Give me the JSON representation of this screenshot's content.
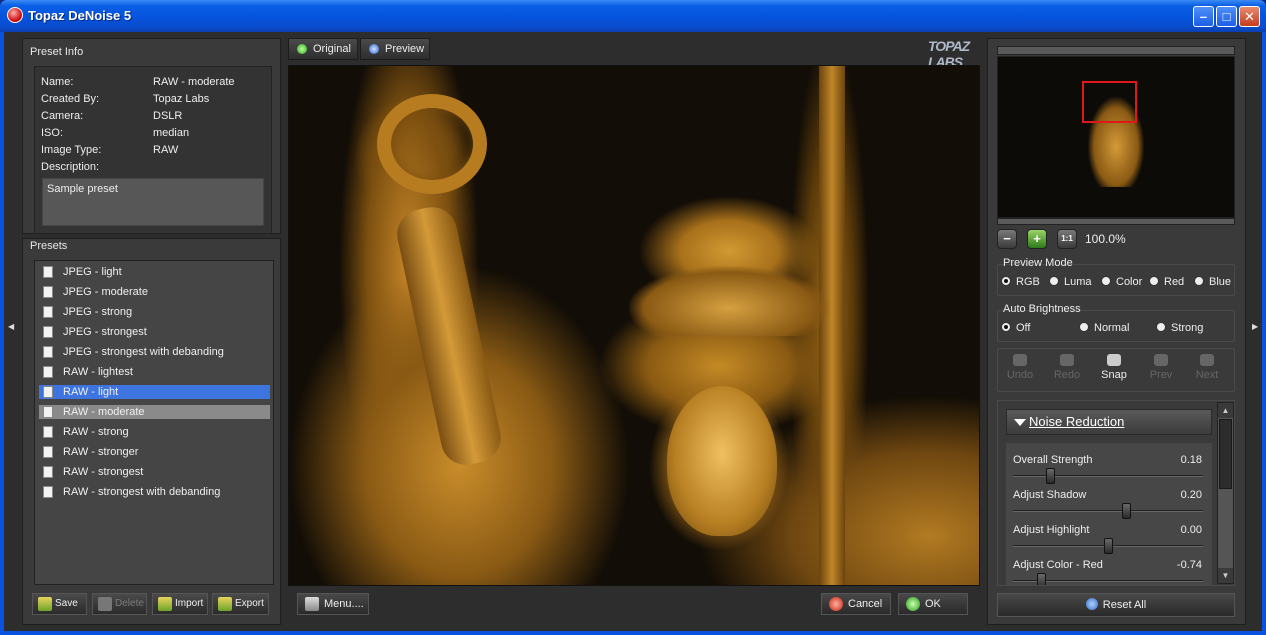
{
  "window": {
    "title": "Topaz DeNoise 5"
  },
  "preset_info": {
    "title": "Preset Info",
    "rows": [
      {
        "label": "Name:",
        "value": "RAW - moderate"
      },
      {
        "label": "Created By:",
        "value": "Topaz Labs"
      },
      {
        "label": "Camera:",
        "value": "DSLR"
      },
      {
        "label": "ISO:",
        "value": "median"
      },
      {
        "label": "Image Type:",
        "value": "RAW"
      },
      {
        "label": "Description:",
        "value": ""
      }
    ],
    "description": "Sample preset"
  },
  "presets": {
    "title": "Presets",
    "items": [
      {
        "label": "JPEG - light"
      },
      {
        "label": "JPEG - moderate"
      },
      {
        "label": "JPEG - strong"
      },
      {
        "label": "JPEG - strongest"
      },
      {
        "label": "JPEG - strongest with debanding"
      },
      {
        "label": "RAW - lightest"
      },
      {
        "label": "RAW - light"
      },
      {
        "label": "RAW - moderate"
      },
      {
        "label": "RAW - strong"
      },
      {
        "label": "RAW - stronger"
      },
      {
        "label": "RAW - strongest"
      },
      {
        "label": "RAW - strongest with debanding"
      }
    ],
    "selected": "RAW - light",
    "highlighted": "RAW - moderate",
    "buttons": {
      "save": "Save",
      "delete": "Delete",
      "import": "Import",
      "export": "Export"
    }
  },
  "view_tabs": {
    "original": "Original",
    "preview": "Preview"
  },
  "brand": {
    "logo": "TOPAZ LABS"
  },
  "footer": {
    "menu": "Menu....",
    "cancel": "Cancel",
    "ok": "OK"
  },
  "zoom": {
    "level": "100.0%",
    "fit": "1:1"
  },
  "preview_mode": {
    "title": "Preview Mode",
    "options": [
      "RGB",
      "Luma",
      "Color",
      "Red",
      "Blue"
    ],
    "selected": "RGB"
  },
  "auto_brightness": {
    "title": "Auto Brightness",
    "options": [
      "Off",
      "Normal",
      "Strong"
    ],
    "selected": "Off"
  },
  "history": {
    "undo": "Undo",
    "redo": "Redo",
    "snap": "Snap",
    "prev": "Prev",
    "next": "Next"
  },
  "noise_reduction": {
    "title": "Noise Reduction",
    "sliders": [
      {
        "label": "Overall Strength",
        "value": "0.18",
        "fraction": 0.18
      },
      {
        "label": "Adjust Shadow",
        "value": "0.20",
        "fraction": 0.6
      },
      {
        "label": "Adjust Highlight",
        "value": "0.00",
        "fraction": 0.5
      },
      {
        "label": "Adjust Color - Red",
        "value": "-0.74",
        "fraction": 0.13
      }
    ]
  },
  "reset": {
    "label": "Reset All"
  },
  "colors": {
    "selection": "#3d74e0",
    "highlight": "#8a8a8a",
    "title_bar": "#0553dd",
    "nav_frame": "#e01818"
  }
}
